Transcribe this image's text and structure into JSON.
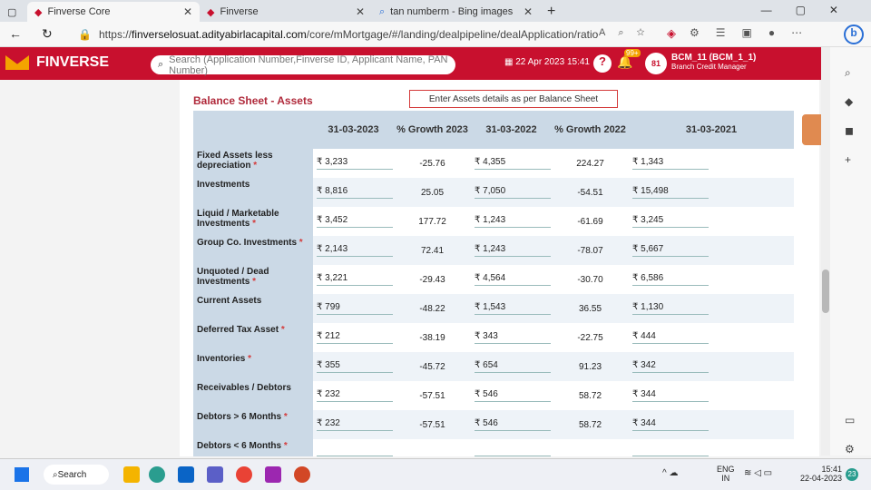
{
  "tabs": [
    {
      "title": "Finverse Core"
    },
    {
      "title": "Finverse"
    },
    {
      "title": "tan numberm - Bing images"
    }
  ],
  "url": {
    "prefix": "https://",
    "host": "finverselosuat.adityabirlacapital.com",
    "path": "/core/mMortgage/#/landing/dealpipeline/dealApplication/ratio"
  },
  "app": {
    "name": "FINVERSE",
    "search_placeholder": "Search (Application Number,Finverse ID, Applicant Name, PAN Number)",
    "date": "22 Apr 2023 15:41",
    "notif": "99+",
    "avatar": "81",
    "user": "BCM_11 (BCM_1_1)",
    "role": "Branch Credit Manager"
  },
  "section": {
    "title": "Balance Sheet - Assets",
    "notice": "Enter Assets details as per Balance Sheet"
  },
  "columns": [
    "",
    "31-03-2023",
    "% Growth 2023",
    "31-03-2022",
    "% Growth 2022",
    "31-03-2021"
  ],
  "rows": [
    {
      "label": "Fixed Assets less depreciation",
      "req": true,
      "v23": "₹ 3,233",
      "g23": "-25.76",
      "v22": "₹ 4,355",
      "g22": "224.27",
      "v21": "₹ 1,343"
    },
    {
      "label": "Investments",
      "req": false,
      "v23": "₹ 8,816",
      "g23": "25.05",
      "v22": "₹ 7,050",
      "g22": "-54.51",
      "v21": "₹ 15,498"
    },
    {
      "label": "Liquid / Marketable Investments",
      "req": true,
      "v23": "₹ 3,452",
      "g23": "177.72",
      "v22": "₹ 1,243",
      "g22": "-61.69",
      "v21": "₹ 3,245"
    },
    {
      "label": "Group Co. Investments",
      "req": true,
      "v23": "₹ 2,143",
      "g23": "72.41",
      "v22": "₹ 1,243",
      "g22": "-78.07",
      "v21": "₹ 5,667"
    },
    {
      "label": "Unquoted / Dead Investments",
      "req": true,
      "v23": "₹ 3,221",
      "g23": "-29.43",
      "v22": "₹ 4,564",
      "g22": "-30.70",
      "v21": "₹ 6,586"
    },
    {
      "label": "Current Assets",
      "req": false,
      "v23": "₹ 799",
      "g23": "-48.22",
      "v22": "₹ 1,543",
      "g22": "36.55",
      "v21": "₹ 1,130"
    },
    {
      "label": "Deferred Tax Asset",
      "req": true,
      "v23": "₹ 212",
      "g23": "-38.19",
      "v22": "₹ 343",
      "g22": "-22.75",
      "v21": "₹ 444"
    },
    {
      "label": "Inventories",
      "req": true,
      "v23": "₹ 355",
      "g23": "-45.72",
      "v22": "₹ 654",
      "g22": "91.23",
      "v21": "₹ 342"
    },
    {
      "label": "Receivables / Debtors",
      "req": false,
      "v23": "₹ 232",
      "g23": "-57.51",
      "v22": "₹ 546",
      "g22": "58.72",
      "v21": "₹ 344"
    },
    {
      "label": "Debtors > 6 Months",
      "req": true,
      "v23": "₹ 232",
      "g23": "-57.51",
      "v22": "₹ 546",
      "g22": "58.72",
      "v21": "₹ 344"
    },
    {
      "label": "Debtors < 6 Months",
      "req": true,
      "v23": "",
      "g23": "",
      "v22": "",
      "g22": "",
      "v21": ""
    }
  ],
  "taskbar": {
    "search": "Search",
    "lang": "ENG",
    "region": "IN",
    "time": "15:41",
    "date": "22-04-2023",
    "badge": "23"
  }
}
